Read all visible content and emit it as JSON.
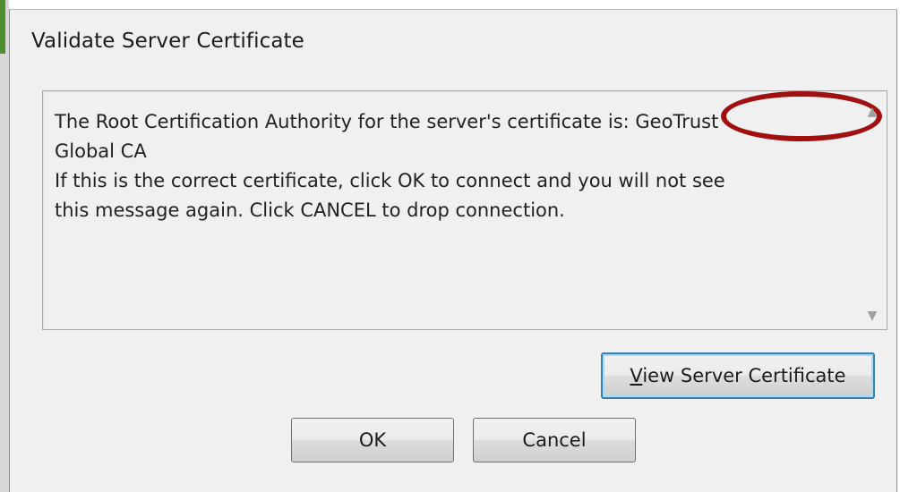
{
  "dialog": {
    "title": "Validate Server Certificate"
  },
  "message": {
    "line1_prefix": "The Root Certification Authority for the server's certificate is: ",
    "line1_cert": "GeoTrust",
    "line2": "Global CA",
    "line3": "If this is the correct certificate, click OK to connect and you will not see",
    "line4": "this message again.  Click CANCEL to drop connection."
  },
  "buttons": {
    "view_certificate": "View Server Certificate",
    "ok": "OK",
    "cancel": "Cancel"
  },
  "colors": {
    "highlight": "#a01010",
    "focus_border": "#3c7fb1"
  },
  "icons": {
    "scroll_up": "scroll-up-arrow-icon",
    "scroll_down": "scroll-down-arrow-icon"
  }
}
